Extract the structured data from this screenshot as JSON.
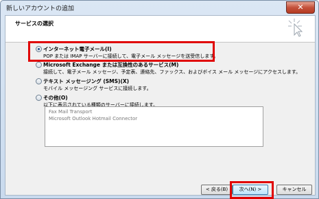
{
  "window": {
    "title": "新しいアカウントの追加",
    "close_glyph": "✕"
  },
  "header": {
    "title": "サービスの選択"
  },
  "options": [
    {
      "label": "インターネット電子メール(I)",
      "desc": "POP または IMAP サーバーに接続して、電子メール メッセージを送受信します。",
      "checked": true
    },
    {
      "label": "Microsoft Exchange または互換性のあるサービス(M)",
      "desc": "接続して、電子メール メッセージ、予定表、連絡先、ファックス、およびボイス メール メッセージにアクセスします。",
      "checked": false
    },
    {
      "label": "テキスト メッセージング (SMS)(X)",
      "desc": "モバイル メッセージング サービスに接続します。",
      "checked": false
    },
    {
      "label": "その他(O)",
      "desc": "以下に表示されている種類のサーバーに接続します。",
      "checked": false
    }
  ],
  "other_list": [
    "Fax Mail Transport",
    "Microsoft Outlook Hotmail Connector"
  ],
  "buttons": {
    "back": "< 戻る(B)",
    "next": "次へ(N) >",
    "cancel": "キャンセル"
  },
  "colors": {
    "highlight": "#e00000",
    "accent": "#1f4f8a"
  }
}
